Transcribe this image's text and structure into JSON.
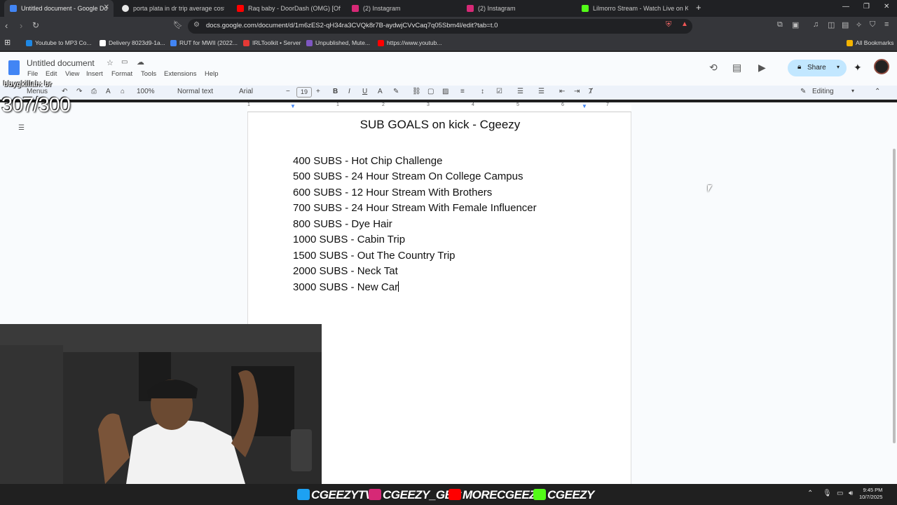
{
  "browser": {
    "tabs": [
      {
        "title": "Untitled document - Google Do",
        "favicon_color": "#4285f4",
        "active": true
      },
      {
        "title": "porta plata in dr trip average cost - B",
        "favicon_color": "#e8e8e8",
        "active": false
      },
      {
        "title": "Raq baby - DoorDash (OMG) [Offici",
        "favicon_color": "#ff0000",
        "active": false
      },
      {
        "title": "(2) Instagram",
        "favicon_color": "#d62976",
        "active": false
      },
      {
        "title": "(2) Instagram",
        "favicon_color": "#d62976",
        "active": false
      },
      {
        "title": "Lilmorro Stream - Watch Live on Kick",
        "favicon_color": "#53fc18",
        "active": false
      }
    ],
    "url": "docs.google.com/document/d/1m6zES2-qH34ra3CVQk8r7B-aydwjCVvCaq7q05Sbm4l/edit?tab=t.0",
    "bookmarks": [
      {
        "label": "Youtube to MP3 Co...",
        "favicon_color": "#1e88e5"
      },
      {
        "label": "Delivery 8023d9-1a...",
        "favicon_color": "#ffffff"
      },
      {
        "label": "RUT for MWII (2022...",
        "favicon_color": "#4285f4"
      },
      {
        "label": "IRLToolkit • Server",
        "favicon_color": "#e53935"
      },
      {
        "label": "Unpublished, Mute...",
        "favicon_color": "#7e57c2"
      },
      {
        "label": "https://www.youtub...",
        "favicon_color": "#ff0000"
      }
    ],
    "all_bookmarks_label": "All Bookmarks"
  },
  "docs": {
    "title": "Untitled document",
    "menus": [
      "File",
      "Edit",
      "View",
      "Insert",
      "Format",
      "Tools",
      "Extensions",
      "Help"
    ],
    "share_label": "Share",
    "toolbar": {
      "menus_label": "Menus",
      "zoom": "100%",
      "style": "Normal text",
      "font": "Arial",
      "font_size": "19",
      "mode": "Editing"
    },
    "ruler_numbers": [
      "1",
      "1",
      "2",
      "3",
      "4",
      "5",
      "6",
      "7"
    ]
  },
  "document": {
    "heading": "SUB GOALS on kick - Cgeezy",
    "goals": [
      "400 SUBS - Hot Chip Challenge",
      "500 SUBS - 24 Hour Stream On College Campus",
      "600 SUBS - 12 Hour Stream With Brothers",
      "700 SUBS - 24 Hour Stream With Female Influencer",
      "800 SUBS - Dye Hair",
      "1000 SUBS - Cabin Trip",
      "1500 SUBS - Out The Country Trip",
      "2000 SUBS - Neck Tat",
      "3000 SUBS - New Car"
    ]
  },
  "stream_overlay": {
    "chat_user": "bbygkillah: br",
    "sub_counter": "307/300",
    "socials": [
      {
        "handle": "CGEEZYTV",
        "icon": "twitter-icon",
        "color": "#1da1f2"
      },
      {
        "handle": "CGEEZY_GBC",
        "icon": "instagram-icon",
        "color": "#d62976"
      },
      {
        "handle": "MORECGEEZY",
        "icon": "youtube-icon",
        "color": "#ff0000"
      },
      {
        "handle": "CGEEZY",
        "icon": "kick-icon",
        "color": "#53fc18"
      }
    ]
  },
  "taskbar": {
    "time": "9:45 PM",
    "date": "10/7/2025"
  }
}
